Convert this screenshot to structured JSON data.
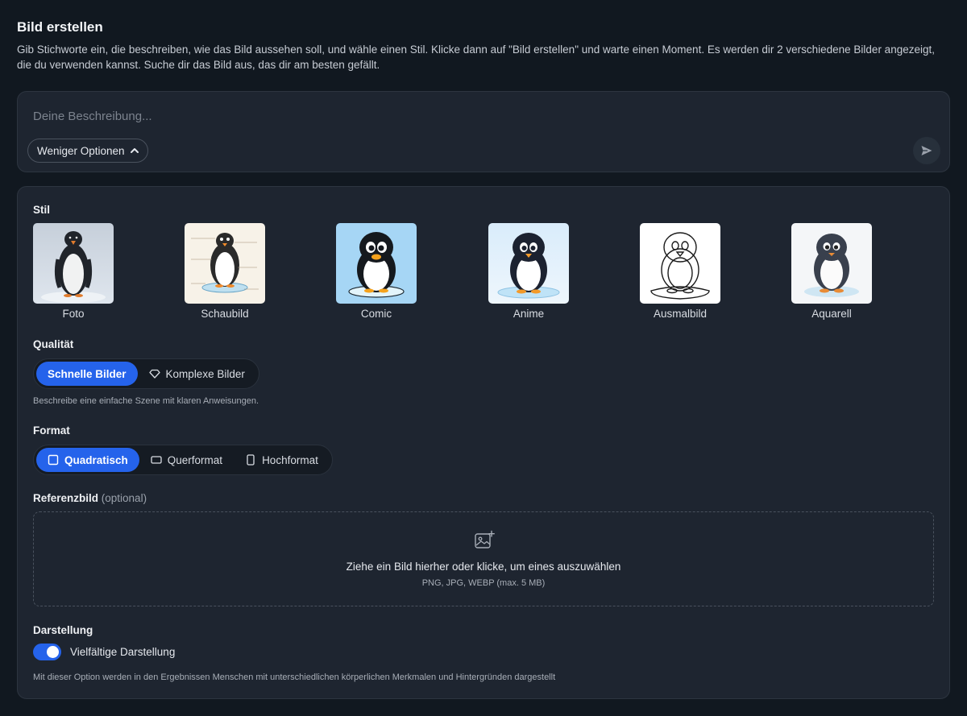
{
  "header": {
    "title": "Bild erstellen",
    "description": "Gib Stichworte ein, die beschreiben, wie das Bild aussehen soll, und wähle einen Stil. Klicke dann auf \"Bild erstellen\" und warte einen Moment. Es werden dir 2 verschiedene Bilder angezeigt, die du verwenden kannst. Suche dir das Bild aus, das dir am besten gefällt."
  },
  "prompt": {
    "placeholder": "Deine Beschreibung...",
    "value": "",
    "less_options_label": "Weniger Optionen"
  },
  "style": {
    "label": "Stil",
    "items": [
      {
        "label": "Foto",
        "icon": "penguin-photo-thumbnail"
      },
      {
        "label": "Schaubild",
        "icon": "penguin-diagram-thumbnail"
      },
      {
        "label": "Comic",
        "icon": "penguin-comic-thumbnail"
      },
      {
        "label": "Anime",
        "icon": "penguin-anime-thumbnail"
      },
      {
        "label": "Ausmalbild",
        "icon": "penguin-coloring-thumbnail"
      },
      {
        "label": "Aquarell",
        "icon": "penguin-watercolor-thumbnail"
      }
    ]
  },
  "quality": {
    "label": "Qualität",
    "options": [
      {
        "label": "Schnelle Bilder",
        "active": true
      },
      {
        "label": "Komplexe Bilder",
        "active": false,
        "icon": "diamond-icon"
      }
    ],
    "hint": "Beschreibe eine einfache Szene mit klaren Anweisungen."
  },
  "format": {
    "label": "Format",
    "options": [
      {
        "label": "Quadratisch",
        "active": true,
        "icon": "square-icon"
      },
      {
        "label": "Querformat",
        "active": false,
        "icon": "landscape-icon"
      },
      {
        "label": "Hochformat",
        "active": false,
        "icon": "portrait-icon"
      }
    ]
  },
  "reference": {
    "label": "Referenzbild",
    "optional": "(optional)",
    "drop_title": "Ziehe ein Bild hierher oder klicke, um eines auszuwählen",
    "drop_sub": "PNG, JPG, WEBP (max. 5 MB)"
  },
  "display": {
    "label": "Darstellung",
    "toggle_label": "Vielfältige Darstellung",
    "toggle_on": true,
    "hint": "Mit dieser Option werden in den Ergebnissen Menschen mit unterschiedlichen körperlichen Merkmalen und Hintergründen dargestellt"
  },
  "colors": {
    "background": "#111820",
    "card": "#1e2530",
    "accent": "#2563eb"
  }
}
